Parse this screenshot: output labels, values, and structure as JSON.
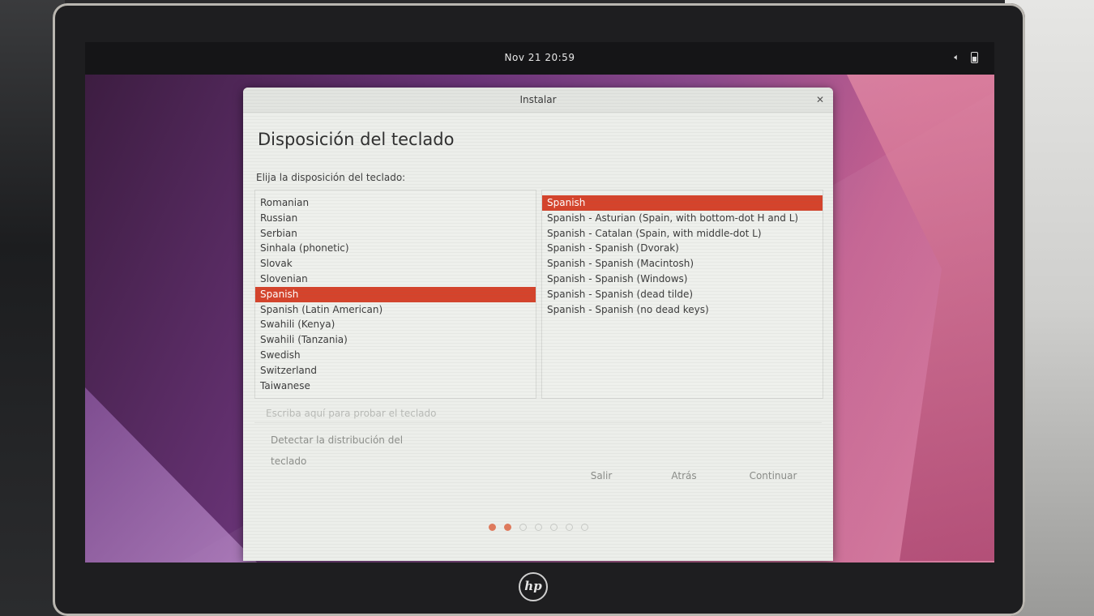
{
  "system": {
    "clock": "Nov 21  20:59",
    "tray_icons": [
      "speaker-icon",
      "battery-icon"
    ]
  },
  "window": {
    "title": "Instalar",
    "close_icon": "close-icon"
  },
  "page": {
    "heading": "Disposición del teclado",
    "prompt": "Elija la disposición del teclado:"
  },
  "layouts": {
    "items": [
      "Romanian",
      "Russian",
      "Serbian",
      "Sinhala (phonetic)",
      "Slovak",
      "Slovenian",
      "Spanish",
      "Spanish (Latin American)",
      "Swahili (Kenya)",
      "Swahili (Tanzania)",
      "Swedish",
      "Switzerland",
      "Taiwanese"
    ],
    "selected": "Spanish"
  },
  "variants": {
    "items": [
      "Spanish",
      "Spanish - Asturian (Spain, with bottom-dot H and L)",
      "Spanish - Catalan (Spain, with middle-dot L)",
      "Spanish - Spanish (Dvorak)",
      "Spanish - Spanish (Macintosh)",
      "Spanish - Spanish (Windows)",
      "Spanish - Spanish (dead tilde)",
      "Spanish - Spanish (no dead keys)"
    ],
    "selected": "Spanish"
  },
  "test_field": {
    "placeholder": "Escriba aquí para probar el teclado"
  },
  "buttons": {
    "detect": "Detectar la distribución del teclado",
    "quit": "Salir",
    "back": "Atrás",
    "continue": "Continuar"
  },
  "progress": {
    "total_steps": 7,
    "completed_steps": 2
  },
  "device": {
    "brand_logo": "hp"
  },
  "colors": {
    "selection": "#d5432b",
    "progress_done": "#e07a5c"
  }
}
